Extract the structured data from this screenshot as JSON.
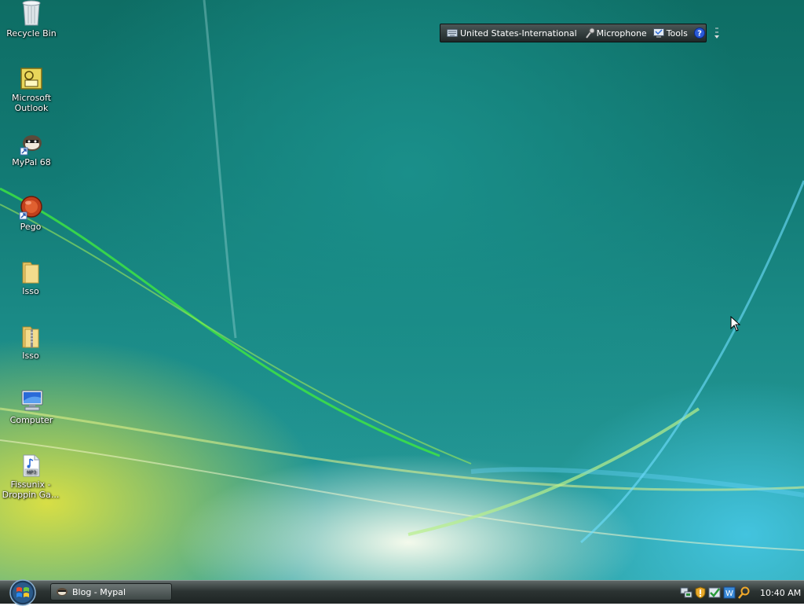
{
  "desktop": {
    "icons": [
      {
        "label_lines": [
          "Recycle Bin"
        ],
        "icon": "recycle-bin-icon"
      },
      {
        "label_lines": [
          "Microsoft",
          "Outlook"
        ],
        "icon": "outlook-icon"
      },
      {
        "label_lines": [
          "MyPal 68"
        ],
        "icon": "mypal-icon"
      },
      {
        "label_lines": [
          "Pego"
        ],
        "icon": "pego-icon"
      },
      {
        "label_lines": [
          "Isso"
        ],
        "icon": "folder-icon"
      },
      {
        "label_lines": [
          "Isso"
        ],
        "icon": "zip-folder-icon"
      },
      {
        "label_lines": [
          "Computer"
        ],
        "icon": "computer-icon"
      },
      {
        "label_lines": [
          "Fissunix -",
          "Droppin Ga..."
        ],
        "icon": "mp3-file-icon"
      }
    ]
  },
  "language_bar": {
    "language": "United States-International",
    "microphone": "Microphone",
    "tools": "Tools",
    "help_glyph": "?"
  },
  "taskbar": {
    "task_button": "Blog - Mypal",
    "clock": "10:40 AM",
    "tray_icons": [
      "network-icon",
      "security-shield-icon",
      "update-check-icon",
      "language-icon",
      "search-icon"
    ]
  },
  "colors": {
    "accent": "#2a9f8c",
    "taskbar": "#2c3433"
  }
}
